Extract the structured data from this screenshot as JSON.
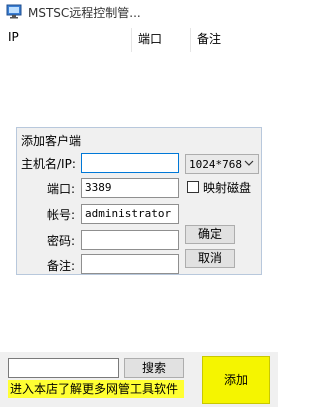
{
  "window": {
    "title": "MSTSC远程控制管..."
  },
  "list": {
    "columns": [
      "IP",
      "端口",
      "备注"
    ]
  },
  "dialog": {
    "title": "添加客户端",
    "host_label": "主机名/IP:",
    "host_value": "",
    "resolution": "1024*768",
    "port_label": "端口:",
    "port_value": "3389",
    "map_disk_label": "映射磁盘",
    "map_disk_checked": false,
    "user_label": "帐号:",
    "user_value": "administrator",
    "password_label": "密码:",
    "password_value": "",
    "note_label": "备注:",
    "note_value": "",
    "ok_label": "确定",
    "cancel_label": "取消"
  },
  "bottom": {
    "search_value": "",
    "search_label": "搜索",
    "promo_text": "进入本店了解更多网管工具软件",
    "add_label": "添加"
  },
  "colors": {
    "promo_bg": "#ffff33",
    "add_bg": "#f5f500",
    "focus_border": "#0078d7"
  }
}
